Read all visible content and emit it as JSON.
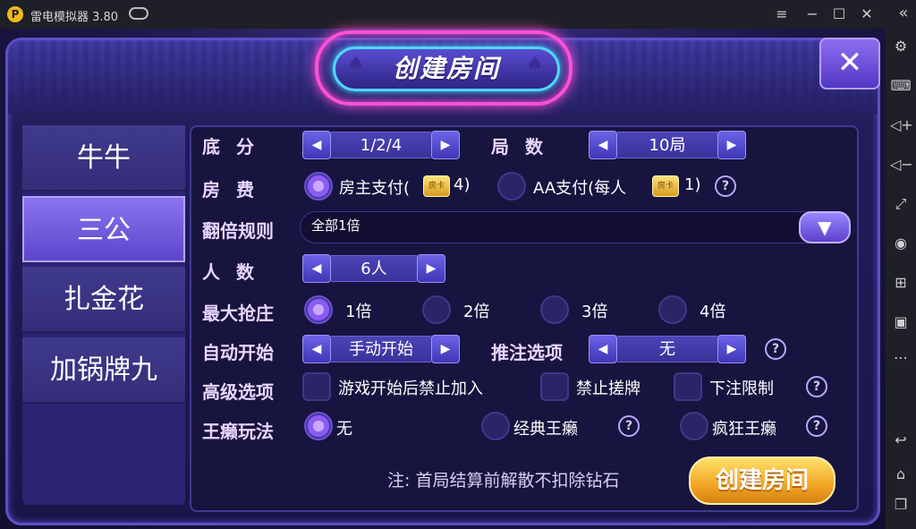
{
  "window": {
    "title": "雷电模拟器 3.80",
    "logo": "P"
  },
  "window_controls": [
    "≡",
    "−",
    "☐",
    "✕"
  ],
  "sidebar_icons": [
    "gear-icon",
    "keyboard-icon",
    "volume-up-icon",
    "volume-down-icon",
    "fullscreen-icon",
    "record-icon",
    "add-window-icon",
    "apk-icon",
    "more-icon",
    "back-icon",
    "home-icon",
    "recent-icon"
  ],
  "dialog": {
    "title": "创建房间",
    "close": "✕"
  },
  "tabs": [
    "牛牛",
    "三公",
    "扎金花",
    "加锅牌九"
  ],
  "active_tab": "三公",
  "rows": {
    "base_score": {
      "label": "底分",
      "value": "1/2/4"
    },
    "rounds": {
      "label": "局数",
      "value": "10局"
    },
    "room_fee": {
      "label": "房费",
      "option1": "房主支付(",
      "option1_count": "4)",
      "option2": "AA支付(每人",
      "option2_count": "1)",
      "ticket": "房卡"
    },
    "multiplier_rule": {
      "label": "翻倍规则",
      "value": "全部1倍"
    },
    "players": {
      "label": "人数",
      "value": "6人"
    },
    "max_bank": {
      "label": "最大抢庄",
      "options": [
        "1倍",
        "2倍",
        "3倍",
        "4倍"
      ],
      "selected": "1倍"
    },
    "auto_start": {
      "label": "自动开始",
      "value": "手动开始"
    },
    "bet_option": {
      "label": "推注选项",
      "value": "无"
    },
    "advanced": {
      "label": "高级选项",
      "options": [
        "游戏开始后禁止加入",
        "禁止搓牌",
        "下注限制"
      ]
    },
    "wildcard": {
      "label": "王癞玩法",
      "options": [
        "无",
        "经典王癞",
        "疯狂王癞"
      ],
      "selected": "无"
    }
  },
  "help": "?",
  "note": "注: 首局结算前解散不扣除钻石",
  "create_button": "创建房间"
}
